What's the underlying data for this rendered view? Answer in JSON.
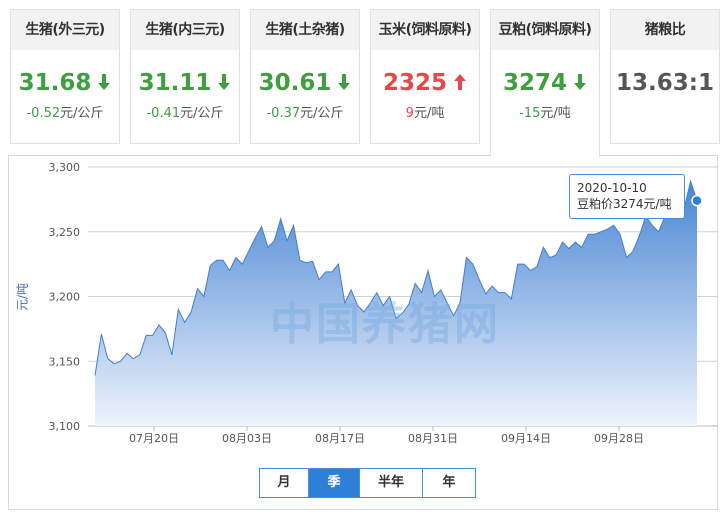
{
  "cards": [
    {
      "title": "生猪(外三元)",
      "price": "31.68",
      "direction": "down",
      "change": "-0.52元/公斤"
    },
    {
      "title": "生猪(内三元)",
      "price": "31.11",
      "direction": "down",
      "change": "-0.41元/公斤"
    },
    {
      "title": "生猪(土杂猪)",
      "price": "30.61",
      "direction": "down",
      "change": "-0.37元/公斤"
    },
    {
      "title": "玉米(饲料原料)",
      "price": "2325",
      "direction": "up",
      "change": "9元/吨"
    },
    {
      "title": "豆粕(饲料原料)",
      "price": "3274",
      "direction": "down",
      "change": "-15元/吨",
      "active": true
    },
    {
      "title": "猪粮比",
      "price": "13.63:1",
      "direction": "none",
      "change": ""
    }
  ],
  "colors": {
    "down": "#3f9f3f",
    "up": "#e64848",
    "series": "#3f7fcf",
    "area_top": "#4a86d4",
    "area_bottom": "#eef4fc"
  },
  "tabs": [
    {
      "label": "月",
      "active": false
    },
    {
      "label": "季",
      "active": true
    },
    {
      "label": "半年",
      "active": false
    },
    {
      "label": "年",
      "active": false
    }
  ],
  "tooltip": {
    "date": "2020-10-10",
    "text": "豆粕价3274元/吨"
  },
  "watermark": "中国养猪网",
  "chart_data": {
    "type": "area",
    "title": "",
    "xlabel": "",
    "ylabel": "元/吨",
    "ylim": [
      3100,
      3300
    ],
    "yticks": [
      "3,100",
      "3,150",
      "3,200",
      "3,250",
      "3,300"
    ],
    "xticks": [
      "07月20日",
      "08月03日",
      "08月17日",
      "08月31日",
      "09月14日",
      "09月28日"
    ],
    "grid": true,
    "x_start": "2020-07-11",
    "series": [
      {
        "values": [
          3139,
          3171,
          3152,
          3148,
          3150,
          3156,
          3152,
          3155,
          3170,
          3170,
          3178,
          3172,
          3155,
          3190,
          3180,
          3188,
          3206,
          3200,
          3224,
          3228,
          3228,
          3220,
          3230,
          3225,
          3235,
          3245,
          3254,
          3238,
          3243,
          3260,
          3243,
          3255,
          3228,
          3226,
          3227,
          3213,
          3219,
          3219,
          3225,
          3195,
          3205,
          3193,
          3188,
          3195,
          3203,
          3193,
          3200,
          3183,
          3187,
          3194,
          3210,
          3203,
          3220,
          3200,
          3205,
          3195,
          3185,
          3195,
          3230,
          3225,
          3213,
          3202,
          3208,
          3203,
          3203,
          3198,
          3225,
          3225,
          3220,
          3223,
          3238,
          3230,
          3232,
          3242,
          3237,
          3242,
          3238,
          3248,
          3248,
          3250,
          3252,
          3255,
          3248,
          3230,
          3235,
          3247,
          3262,
          3255,
          3250,
          3262,
          3266,
          3265,
          3268,
          3289,
          3274
        ]
      }
    ]
  }
}
